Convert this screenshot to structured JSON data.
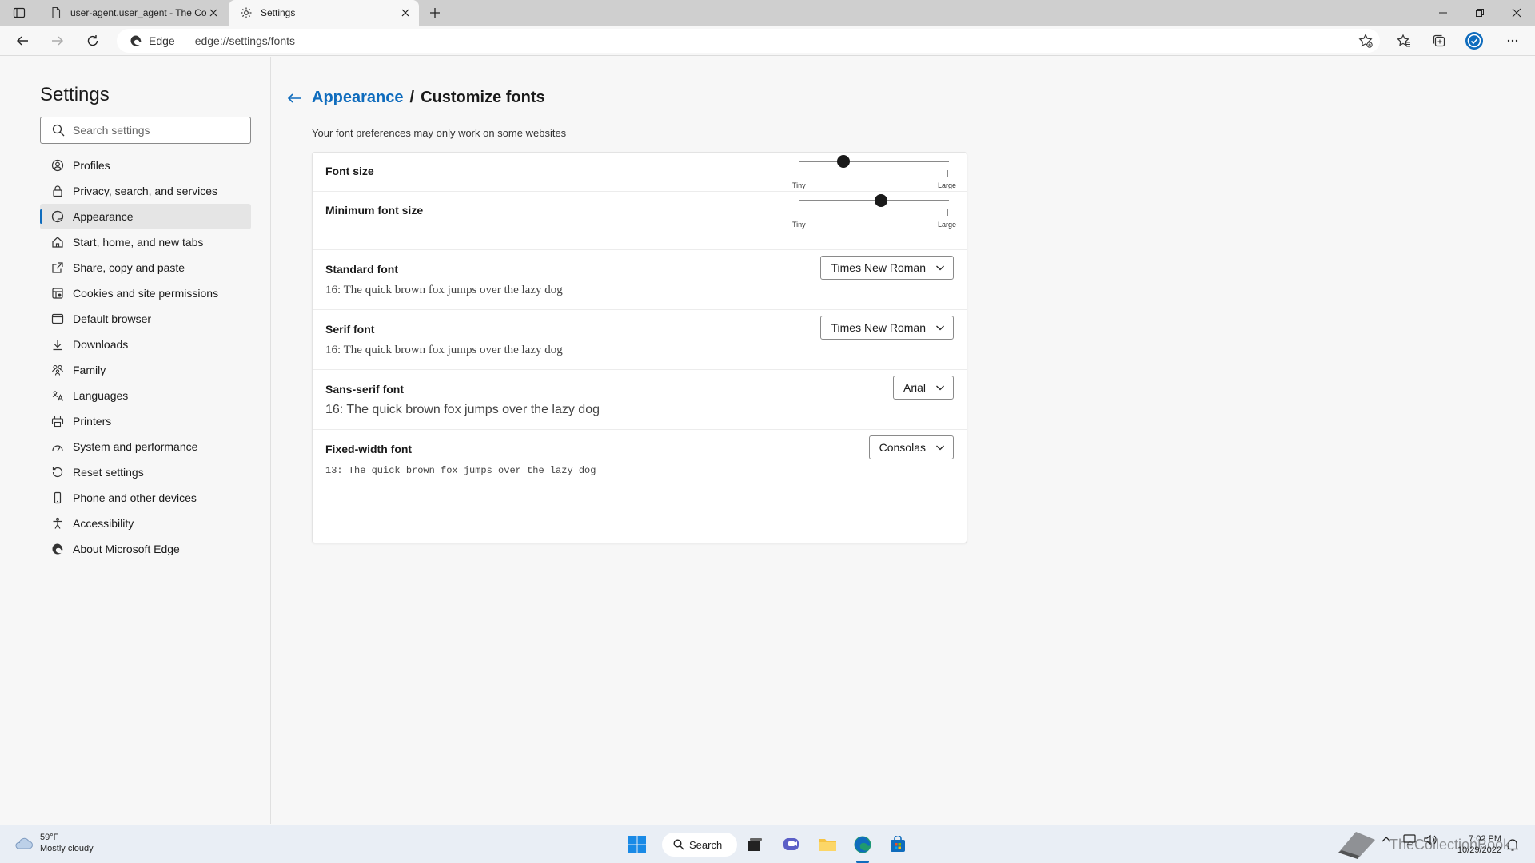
{
  "tabs": [
    {
      "title": "user-agent.user_agent - The Coll",
      "icon": "document-icon"
    },
    {
      "title": "Settings",
      "icon": "gear-icon"
    }
  ],
  "address_bar": {
    "identity_label": "Edge",
    "url": "edge://settings/fonts"
  },
  "sidebar": {
    "title": "Settings",
    "search_placeholder": "Search settings",
    "items": [
      {
        "label": "Profiles",
        "icon": "profile-icon"
      },
      {
        "label": "Privacy, search, and services",
        "icon": "lock-icon"
      },
      {
        "label": "Appearance",
        "icon": "appearance-icon",
        "active": true
      },
      {
        "label": "Start, home, and new tabs",
        "icon": "home-icon"
      },
      {
        "label": "Share, copy and paste",
        "icon": "share-icon"
      },
      {
        "label": "Cookies and site permissions",
        "icon": "cookies-icon"
      },
      {
        "label": "Default browser",
        "icon": "browser-icon"
      },
      {
        "label": "Downloads",
        "icon": "download-icon"
      },
      {
        "label": "Family",
        "icon": "family-icon"
      },
      {
        "label": "Languages",
        "icon": "languages-icon"
      },
      {
        "label": "Printers",
        "icon": "printer-icon"
      },
      {
        "label": "System and performance",
        "icon": "performance-icon"
      },
      {
        "label": "Reset settings",
        "icon": "reset-icon"
      },
      {
        "label": "Phone and other devices",
        "icon": "phone-icon"
      },
      {
        "label": "Accessibility",
        "icon": "accessibility-icon"
      },
      {
        "label": "About Microsoft Edge",
        "icon": "edge-icon"
      }
    ]
  },
  "page": {
    "breadcrumb_parent": "Appearance",
    "breadcrumb_separator": "/",
    "breadcrumb_current": "Customize fonts",
    "note": "Your font preferences may only work on some websites",
    "font_size": {
      "label": "Font size",
      "min_label": "Tiny",
      "max_label": "Large",
      "level": 0.3
    },
    "minimum_font_size": {
      "label": "Minimum font size",
      "min_label": "Tiny",
      "max_label": "Large",
      "level": 0.55
    },
    "standard_font": {
      "label": "Standard font",
      "sample": "16: The quick brown fox jumps over the lazy dog",
      "selected": "Times New Roman"
    },
    "serif_font": {
      "label": "Serif font",
      "sample": "16: The quick brown fox jumps over the lazy dog",
      "selected": "Times New Roman"
    },
    "sans_serif_font": {
      "label": "Sans-serif font",
      "sample": "16: The quick brown fox jumps over the lazy dog",
      "selected": "Arial"
    },
    "fixed_width_font": {
      "label": "Fixed-width font",
      "sample": "13: The quick brown fox jumps over the lazy dog",
      "selected": "Consolas"
    }
  },
  "taskbar": {
    "weather_temp": "59°F",
    "weather_desc": "Mostly cloudy",
    "search_label": "Search",
    "time": "7:02 PM",
    "date": "10/29/2022"
  },
  "watermark": "TheCollectionBook",
  "colors": {
    "accent": "#0f6cbd",
    "active_nav_bg": "#e5e5e5"
  }
}
